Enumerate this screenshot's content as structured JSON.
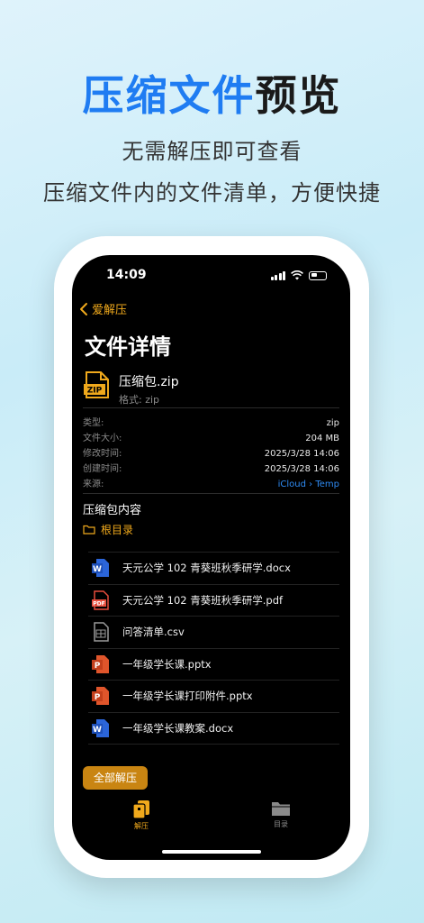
{
  "hero": {
    "title_accent": "压缩文件",
    "title_rest": "预览",
    "subtitle_1": "无需解压即可查看",
    "subtitle_2": "压缩文件内的文件清单，方便快捷"
  },
  "status_bar": {
    "time": "14:09"
  },
  "nav": {
    "back_label": "爱解压"
  },
  "page": {
    "title": "文件详情"
  },
  "file": {
    "name": "压缩包.zip",
    "format": "格式: zip",
    "icon_text": "ZIP"
  },
  "meta": [
    {
      "key": "类型:",
      "value": "zip"
    },
    {
      "key": "文件大小:",
      "value": "204 MB"
    },
    {
      "key": "修改时间:",
      "value": "2025/3/28 14:06"
    },
    {
      "key": "创建时间:",
      "value": "2025/3/28 14:06"
    },
    {
      "key": "来源:",
      "value": "iCloud › Temp"
    }
  ],
  "archive": {
    "section_title": "压缩包内容",
    "root_label": "根目录",
    "files": [
      {
        "name": "天元公学 102 青葵班秋季研学.docx",
        "icon": "word-icon"
      },
      {
        "name": "天元公学 102 青葵班秋季研学.pdf",
        "icon": "pdf-icon"
      },
      {
        "name": "问答清单.csv",
        "icon": "csv-icon"
      },
      {
        "name": "一年级学长课.pptx",
        "icon": "powerpoint-icon"
      },
      {
        "name": "一年级学长课打印附件.pptx",
        "icon": "powerpoint-icon"
      },
      {
        "name": "一年级学长课教案.docx",
        "icon": "word-icon"
      }
    ]
  },
  "actions": {
    "extract_all": "全部解压"
  },
  "tabs": [
    {
      "label": "解压",
      "active": true
    },
    {
      "label": "目录",
      "active": false
    }
  ],
  "colors": {
    "accent": "#f0a91c",
    "blue": "#1f7cf2",
    "link": "#2f8cf5"
  }
}
